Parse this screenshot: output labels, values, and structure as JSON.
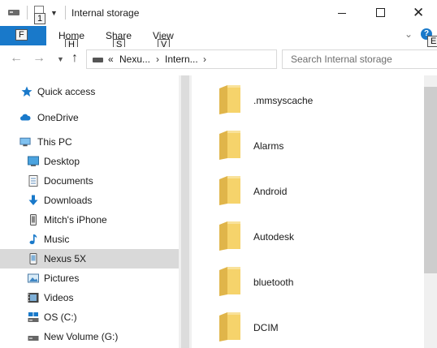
{
  "window": {
    "title": "Internal storage",
    "quick_access_keytip": "1",
    "file_keytip": "F",
    "help_keytip": "E",
    "minimize_icon": "minimize-icon",
    "maximize_icon": "maximize-icon",
    "close_icon": "close-icon"
  },
  "ribbon": {
    "tabs": [
      {
        "label": "Home",
        "keytip": "H"
      },
      {
        "label": "Share",
        "keytip": "S"
      },
      {
        "label": "View",
        "keytip": "V"
      }
    ]
  },
  "address": {
    "overflow": "«",
    "segments": [
      "Nexu...",
      "Intern..."
    ],
    "search_placeholder": "Search Internal storage"
  },
  "nav_pane": {
    "items": [
      {
        "label": "Quick access",
        "icon": "star-icon"
      },
      {
        "label": "OneDrive",
        "icon": "cloud-icon"
      },
      {
        "label": "This PC",
        "icon": "computer-icon"
      },
      {
        "label": "Desktop",
        "icon": "desktop-icon"
      },
      {
        "label": "Documents",
        "icon": "documents-icon"
      },
      {
        "label": "Downloads",
        "icon": "download-icon"
      },
      {
        "label": "Mitch's iPhone",
        "icon": "phone-icon"
      },
      {
        "label": "Music",
        "icon": "music-icon"
      },
      {
        "label": "Nexus 5X",
        "icon": "device-icon",
        "selected": true
      },
      {
        "label": "Pictures",
        "icon": "pictures-icon"
      },
      {
        "label": "Videos",
        "icon": "videos-icon"
      },
      {
        "label": "OS (C:)",
        "icon": "os-drive-icon"
      },
      {
        "label": "New Volume (G:)",
        "icon": "drive-icon"
      }
    ]
  },
  "folders": [
    {
      "name": ".mmsyscache"
    },
    {
      "name": "Alarms"
    },
    {
      "name": "Android"
    },
    {
      "name": "Autodesk"
    },
    {
      "name": "bluetooth"
    },
    {
      "name": "DCIM"
    }
  ],
  "colors": {
    "accent": "#1979ca",
    "folder": "#f6d36b",
    "selection": "#d9d9d9"
  }
}
